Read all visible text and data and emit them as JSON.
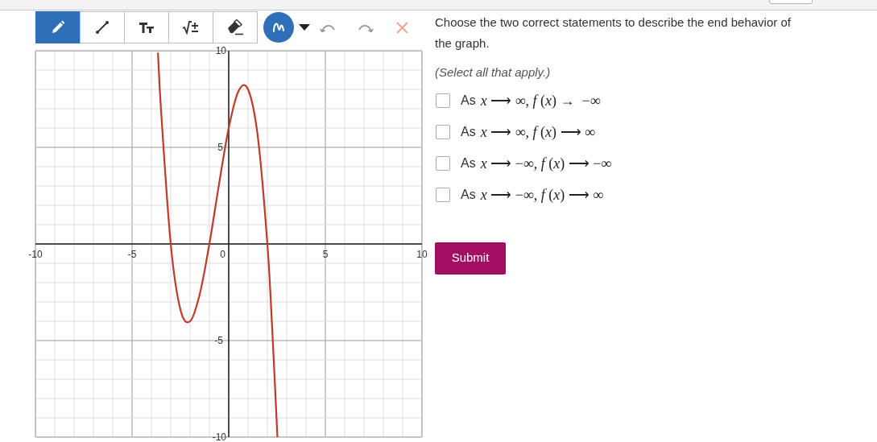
{
  "toolbar": {
    "tools": [
      {
        "kind": "pencil",
        "selected": true
      },
      {
        "kind": "line",
        "selected": false
      },
      {
        "kind": "text",
        "selected": false
      },
      {
        "kind": "math",
        "selected": false
      },
      {
        "kind": "eraser",
        "selected": false
      }
    ]
  },
  "graph": {
    "chart_data": {
      "type": "line",
      "xlim": [
        -10,
        10
      ],
      "ylim": [
        -10,
        10
      ],
      "xticks": [
        -10,
        -5,
        0,
        5,
        10
      ],
      "yticks": [
        -10,
        -5,
        5,
        10
      ],
      "grid": true,
      "x": [
        -3.66,
        -3.5,
        -3,
        -2.5,
        -2,
        -1.5,
        -1,
        -0.5,
        0,
        0.5,
        1,
        1.5,
        2,
        2.25,
        2.52
      ],
      "series": [
        {
          "color": "#c0392b",
          "values": [
            9.9,
            6.9,
            0,
            -3.4,
            -4,
            -2.6,
            0,
            3.1,
            6,
            7.9,
            8,
            5.6,
            0,
            -4.4,
            -10
          ]
        }
      ]
    }
  },
  "question": {
    "prompt": "Choose the two correct statements to describe the end behavior of the graph.",
    "hint": "(Select all that apply.)",
    "options": [
      {
        "prefix": "As",
        "math": "*x* ⟶ ∞, *f* (*x*) →  −∞",
        "checked": false
      },
      {
        "prefix": "As",
        "math": "*x* ⟶ ∞, *f* (*x*) ⟶ ∞",
        "checked": false
      },
      {
        "prefix": "As",
        "math": "*x* ⟶ −∞, *f* (*x*) ⟶ −∞",
        "checked": false
      },
      {
        "prefix": "As",
        "math": "*x* ⟶ −∞, *f* (*x*) ⟶ ∞",
        "checked": false
      }
    ],
    "submit": "Submit"
  }
}
